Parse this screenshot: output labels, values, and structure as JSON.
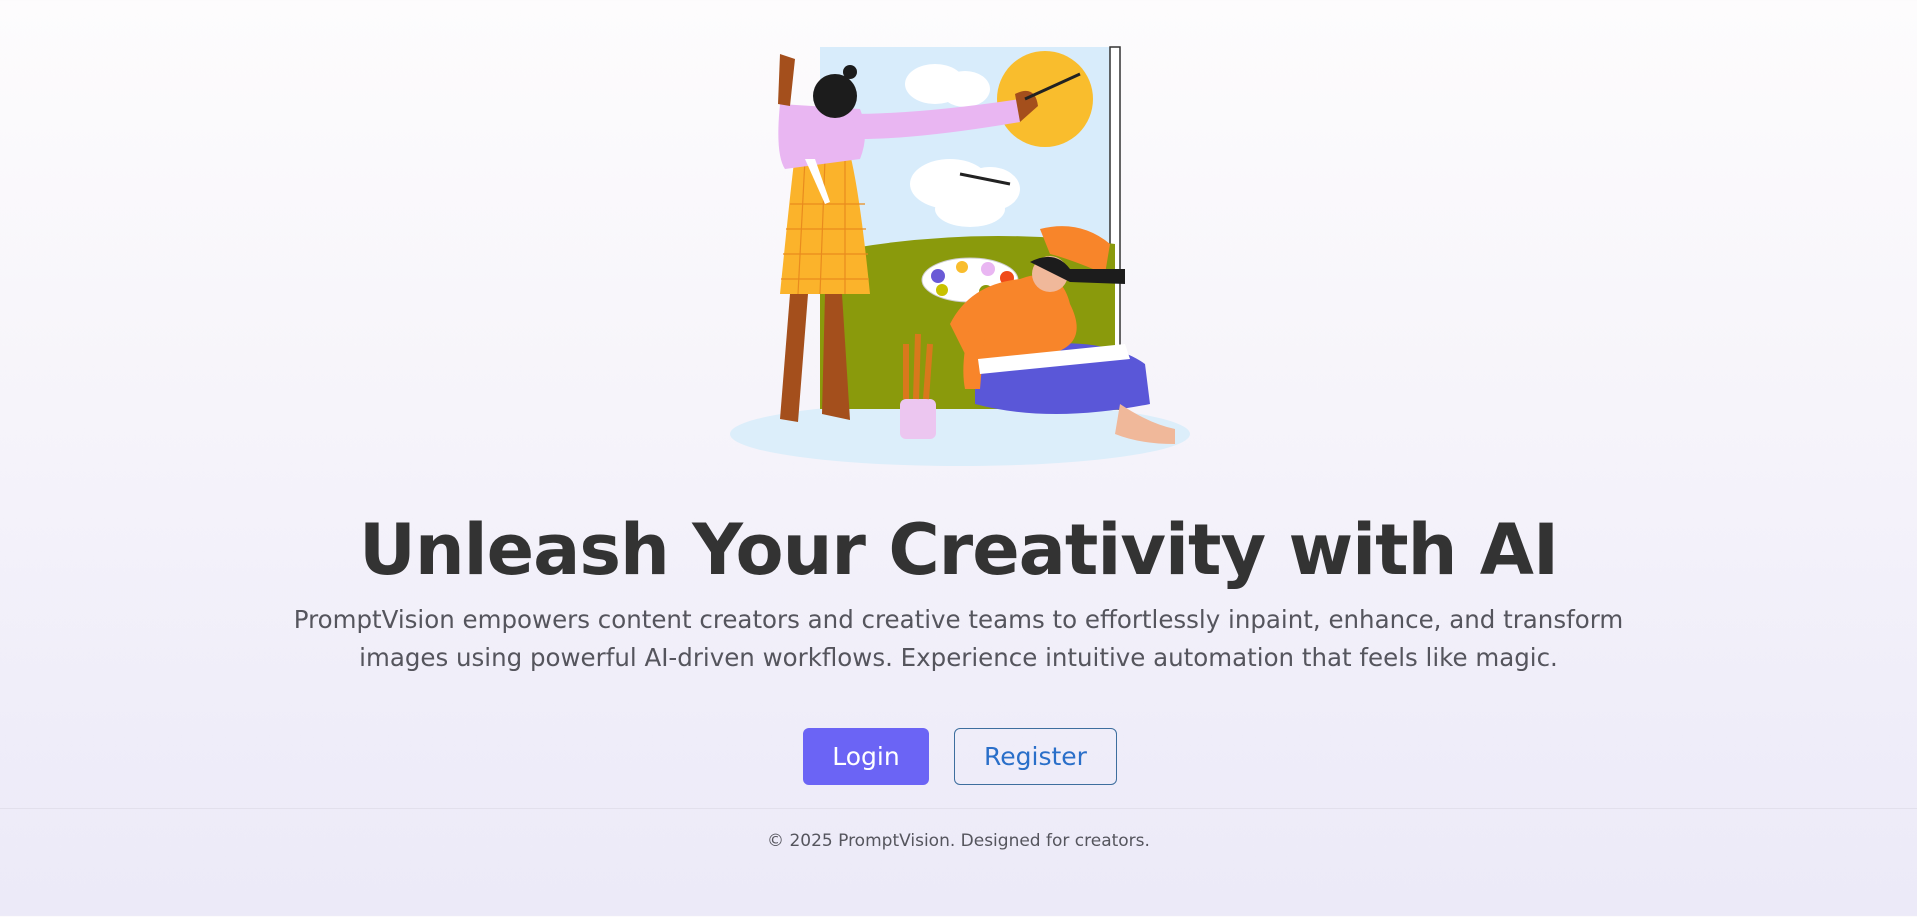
{
  "hero": {
    "illustration": "two-painters-at-canvas-illustration",
    "title": "Unleash Your Creativity with AI",
    "description": "PromptVision empowers content creators and creative teams to effortlessly inpaint, enhance, and transform images using powerful AI-driven workflows. Experience intuitive automation that feels like magic."
  },
  "actions": {
    "login_label": "Login",
    "register_label": "Register"
  },
  "footer": {
    "copyright": "© 2025 PromptVision. Designed for creators."
  },
  "colors": {
    "primary": "#6b64f5",
    "link": "#2a6fc9",
    "heading": "#333333",
    "body_text": "#55555d"
  }
}
